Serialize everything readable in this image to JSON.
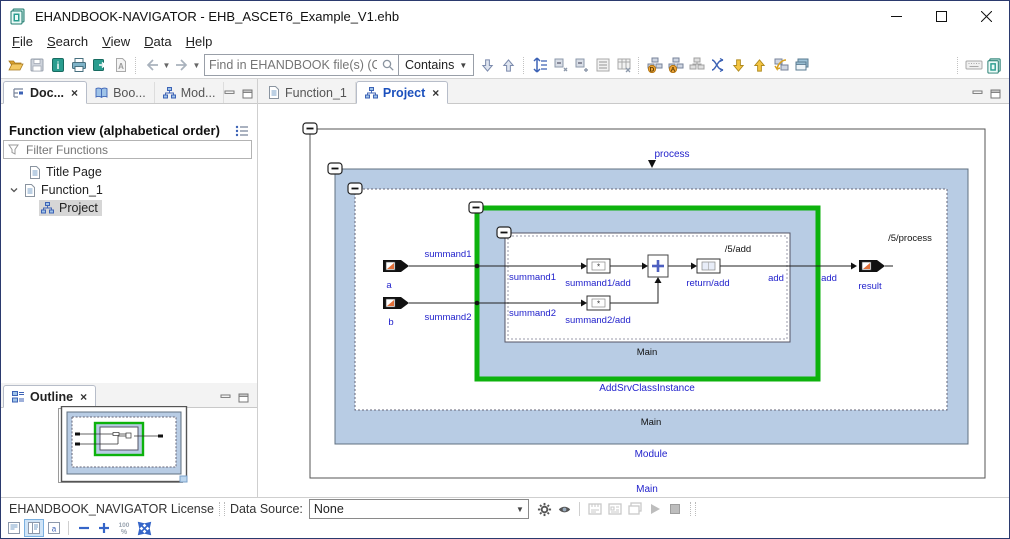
{
  "window": {
    "title": "EHANDBOOK-NAVIGATOR - EHB_ASCET6_Example_V1.ehb",
    "controls": [
      "minimize",
      "maximize",
      "close"
    ]
  },
  "menu": {
    "items": [
      {
        "label": "File"
      },
      {
        "label": "Search"
      },
      {
        "label": "View"
      },
      {
        "label": "Data"
      },
      {
        "label": "Help"
      }
    ]
  },
  "toolbar": {
    "find_placeholder": "Find in EHANDBOOK file(s) (Ctrl+H)",
    "contains_label": "Contains",
    "icons": [
      "open-file",
      "save",
      "info-book",
      "print",
      "export",
      "pdf-export",
      "nav-back",
      "nav-forward",
      "search",
      "find-next",
      "find-previous",
      "expand-all",
      "collapse-all",
      "collapse-selected",
      "form-view",
      "table-view",
      "show-ids",
      "show-labels",
      "diagram-view",
      "navigate-links",
      "go-into",
      "go-up",
      "go-back-diagram",
      "new-window",
      "keyboard-shortcuts",
      "app-logo"
    ]
  },
  "left_panel": {
    "tabs": [
      {
        "label": "Doc..."
      },
      {
        "label": "Boo..."
      },
      {
        "label": "Mod..."
      }
    ],
    "function_view": {
      "title": "Function view (alphabetical order)",
      "filter_placeholder": "Filter Functions",
      "tree": [
        {
          "label": "Title Page"
        },
        {
          "label": "Function_1"
        },
        {
          "label": "Project"
        }
      ]
    },
    "outline": {
      "tab_label": "Outline"
    }
  },
  "editor": {
    "tabs": [
      {
        "label": "Function_1"
      },
      {
        "label": "Project"
      }
    ]
  },
  "diagram": {
    "labels": {
      "process": "process",
      "outer_main": "Main",
      "module": "Module",
      "dashed_main": "Main",
      "class_instance": "AddSrvClassInstance",
      "inner_main": "Main",
      "port_a": "a",
      "port_b": "b",
      "port_result": "result",
      "wire_summand1": "summand1",
      "wire_summand2": "summand2",
      "inner_summand1": "summand1",
      "inner_summand2": "summand2",
      "block_summand1": "summand1/add",
      "block_summand2": "summand2/add",
      "block_return": "return/add",
      "path_add": "/5/add",
      "path_process": "/5/process",
      "add_left": "add",
      "add_right": "add"
    },
    "colors": {
      "container_fill": "#b8cce4",
      "highlight_border": "#0db20d",
      "label_blue": "#2222cc"
    }
  },
  "statusbar": {
    "license": "EHANDBOOK_NAVIGATOR License",
    "data_source_label": "Data Source:",
    "data_source_value": "None"
  }
}
